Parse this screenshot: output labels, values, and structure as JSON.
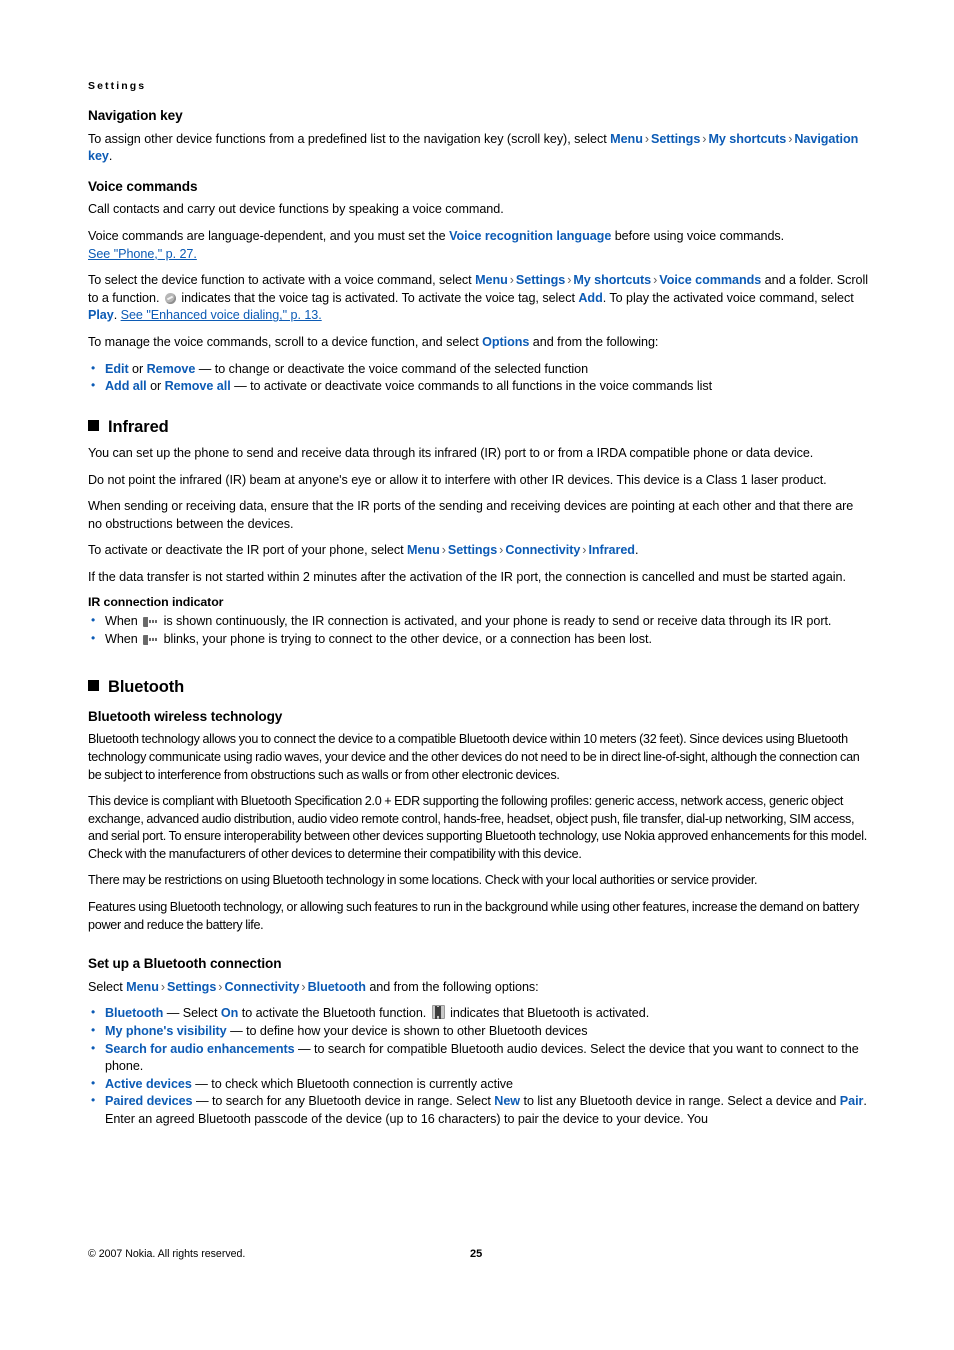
{
  "document": {
    "running_head": "Settings",
    "footer": {
      "copyright": "© 2007 Nokia. All rights reserved.",
      "page_number": "25"
    },
    "accent_color": "#0c5bb5"
  },
  "navigation_key": {
    "heading": "Navigation key",
    "para_lead": "To assign other device functions from a predefined list to the navigation key (scroll key), select ",
    "kw_menu": "Menu",
    "kw_settings": "Settings",
    "kw_my_shortcuts": "My shortcuts",
    "kw_navigation_key": "Navigation key",
    "para_end": "."
  },
  "voice_commands": {
    "heading": "Voice commands",
    "p1": "Call contacts and carry out device functions by speaking a voice command.",
    "p2_a": "Voice commands are language-dependent, and you must set the ",
    "p2_kw": "Voice recognition language",
    "p2_b": " before using voice commands. ",
    "p2_xref": "See \"Phone,\" p. 27.",
    "p3_a": "To select the device function to activate with a voice command, select ",
    "p3_kw_menu": "Menu",
    "p3_kw_settings": "Settings",
    "p3_kw_my_shortcuts": "My shortcuts",
    "p3_kw_voice_commands": "Voice commands",
    "p3_b": " and a folder. Scroll to a function. ",
    "p3_c": " indicates that the voice tag is activated. To activate the voice tag, select ",
    "p3_kw_add": "Add",
    "p3_d": ". To play the activated voice command, select ",
    "p3_kw_play": "Play",
    "p3_e": ". ",
    "p3_xref": "See \"Enhanced voice dialing,\" p. 13.",
    "p4_a": "To manage the voice commands, scroll to a device function, and select ",
    "p4_kw": "Options",
    "p4_b": " and from the following:",
    "bullets": [
      {
        "kw1": "Edit",
        "mid": " or ",
        "kw2": "Remove",
        "text": " — to change or deactivate the voice command of the selected function"
      },
      {
        "kw1": "Add all",
        "mid": " or ",
        "kw2": "Remove all",
        "text": " — to activate or deactivate voice commands to all functions in the voice commands list"
      }
    ]
  },
  "infrared": {
    "heading": "Infrared",
    "p1": "You can set up the phone to send and receive data through its infrared (IR) port to or from a IRDA compatible phone or data device.",
    "p2": "Do not point the infrared (IR) beam at anyone's eye or allow it to interfere with other IR devices. This device is a Class 1 laser product.",
    "p3": "When sending or receiving data, ensure that the IR ports of the sending and receiving devices are pointing at each other and that there are no obstructions between the devices.",
    "p4_a": "To activate or deactivate the IR port of your phone, select ",
    "p4_kw_menu": "Menu",
    "p4_kw_settings": "Settings",
    "p4_kw_connectivity": "Connectivity",
    "p4_kw_infrared": "Infrared",
    "p4_b": ".",
    "p5": "If the data transfer is not started within 2 minutes after the activation of the IR port, the connection is cancelled and must be started again.",
    "indicator_heading": "IR connection indicator",
    "bullet1_a": "When ",
    "bullet1_b": " is shown continuously, the IR connection is activated, and your phone is ready to send or receive data through its IR port.",
    "bullet2_a": "When ",
    "bullet2_b": " blinks, your phone is trying to connect to the other device, or a connection has been lost."
  },
  "bluetooth": {
    "heading": "Bluetooth",
    "wireless_tech": {
      "heading": "Bluetooth wireless technology",
      "p1": "Bluetooth technology allows you to connect the device to a compatible Bluetooth device within 10 meters (32 feet). Since devices using Bluetooth technology communicate using radio waves, your device and the other devices do not need to be in direct line-of-sight, although the connection can be subject to interference from obstructions such as walls or from other electronic devices.",
      "p2": "This device is compliant with Bluetooth Specification 2.0 + EDR supporting the following profiles: generic access, network access, generic object exchange, advanced audio distribution, audio video remote control, hands-free, headset, object push, file transfer, dial-up networking, SIM access, and serial port. To ensure interoperability between other devices supporting Bluetooth technology, use Nokia approved enhancements for this model. Check with the manufacturers of other devices to determine their compatibility with this device.",
      "p3": "There may be restrictions on using Bluetooth technology in some locations. Check with your local authorities or service provider.",
      "p4": "Features using Bluetooth technology, or allowing such features to run in the background while using other features, increase the demand on battery power and reduce the battery life."
    },
    "setup": {
      "heading": "Set up a Bluetooth connection",
      "lead_a": "Select ",
      "kw_menu": "Menu",
      "kw_settings": "Settings",
      "kw_connectivity": "Connectivity",
      "kw_bluetooth": "Bluetooth",
      "lead_b": " and from the following options:",
      "bullet_bluetooth": {
        "kw": "Bluetooth",
        "a": " —  Select ",
        "kw_on": "On",
        "b": " to activate the Bluetooth function. ",
        "c": " indicates that Bluetooth is activated."
      },
      "bullet_visibility": {
        "kw": "My phone's visibility",
        "text": " — to define how your device is shown to other Bluetooth devices"
      },
      "bullet_search_audio": {
        "kw": "Search for audio enhancements",
        "text": " — to search for compatible Bluetooth audio devices. Select the device that you want to connect to the phone."
      },
      "bullet_active": {
        "kw": "Active devices",
        "text": " — to check which Bluetooth connection is currently active"
      },
      "bullet_paired": {
        "kw": "Paired devices",
        "a": " — to search for any Bluetooth device in range. Select ",
        "kw_new": "New",
        "b": " to list any Bluetooth device in range. Select a device and ",
        "kw_pair": "Pair",
        "c": ". Enter an agreed Bluetooth passcode of the device (up to 16 characters) to pair the device to your device. You"
      }
    }
  },
  "icons": {
    "voice_tag": "voice-tag-icon",
    "ir_beam": "ir-beam-icon",
    "bluetooth_active": "bluetooth-active-icon",
    "section_square": "section-square-bullet"
  }
}
